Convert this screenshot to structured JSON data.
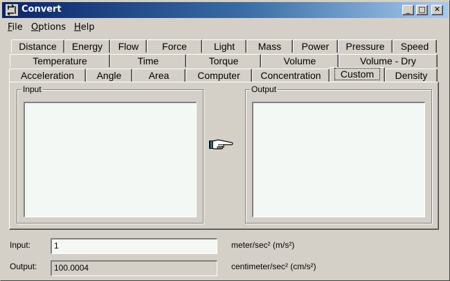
{
  "window": {
    "title": "Convert",
    "controls": {
      "minimize": "_",
      "maximize": "□",
      "close": "✕"
    }
  },
  "menu": [
    {
      "label": "File",
      "accel": "F",
      "rest": "ile"
    },
    {
      "label": "Options",
      "accel": "O",
      "rest": "ptions"
    },
    {
      "label": "Help",
      "accel": "H",
      "rest": "elp"
    }
  ],
  "tabs": {
    "row1": [
      "Distance",
      "Energy",
      "Flow",
      "Force",
      "Light",
      "Mass",
      "Power",
      "Pressure",
      "Speed"
    ],
    "row2": [
      "Temperature",
      "Time",
      "Torque",
      "Volume",
      "Volume - Dry"
    ],
    "row3": [
      "Acceleration",
      "Angle",
      "Area",
      "Computer",
      "Concentration",
      "Custom",
      "Density"
    ],
    "selected": "Custom"
  },
  "panel": {
    "input_group_label": "Input",
    "output_group_label": "Output",
    "convert_icon": "pointing-hand-icon"
  },
  "conversion": {
    "input_label": "Input:",
    "input_value": "1",
    "input_unit": "meter/sec² (m/s²)",
    "output_label": "Output:",
    "output_value": "100.0004",
    "output_unit": "centimeter/sec² (cm/s²)"
  },
  "colors": {
    "face": "#d4d0c8",
    "titlebar_start": "#0a246a",
    "titlebar_end": "#a6caf0",
    "list_bg": "#f4f8f4"
  }
}
